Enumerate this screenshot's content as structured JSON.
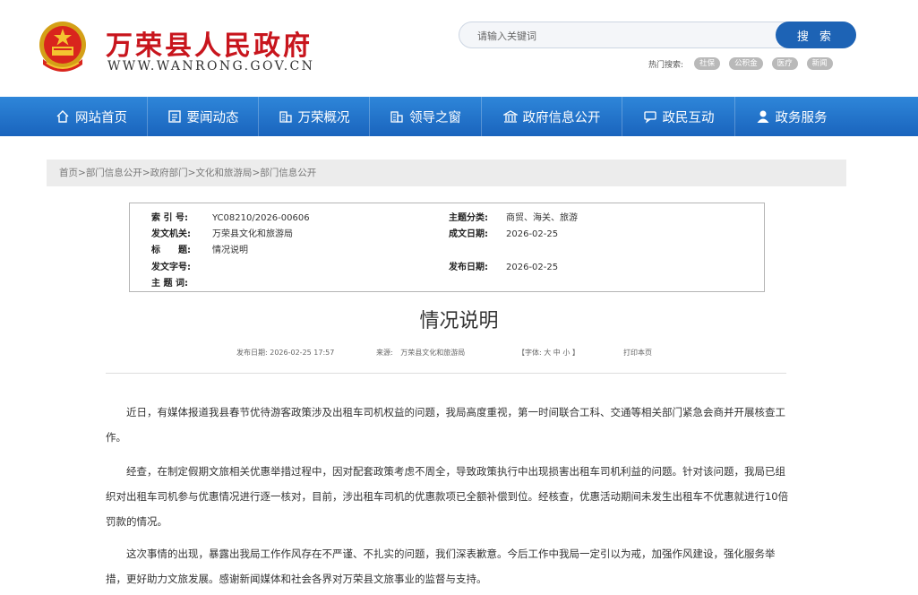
{
  "header": {
    "title": "万荣县人民政府",
    "domain": "WWW.WANRONG.GOV.CN",
    "search": {
      "placeholder": "请输入关键词",
      "button_label": "搜 索"
    },
    "hotwords": {
      "label": "热门搜索:",
      "tags": [
        "社保",
        "公积金",
        "医疗",
        "新闻"
      ]
    }
  },
  "nav": {
    "items": [
      {
        "label": "网站首页",
        "icon": "home-icon"
      },
      {
        "label": "要闻动态",
        "icon": "news-icon"
      },
      {
        "label": "万荣概况",
        "icon": "building-icon"
      },
      {
        "label": "领导之窗",
        "icon": "building-icon"
      },
      {
        "label": "政府信息公开",
        "icon": "government-icon"
      },
      {
        "label": "政民互动",
        "icon": "chat-icon"
      },
      {
        "label": "政务服务",
        "icon": "user-icon"
      }
    ]
  },
  "breadcrumb": [
    "首页",
    "部门信息公开",
    "政府部门",
    "文化和旅游局",
    "部门信息公开"
  ],
  "info": {
    "index_label": "索 引 号:",
    "index_value": "YC08210/2026-00606",
    "org_label": "发文机关:",
    "org_value": "万荣县文化和旅游局",
    "title_label": "标　　题:",
    "title_value": "情况说明",
    "doc_no_label": "发文字号:",
    "doc_no_value": "",
    "keywords_label": "主 题 词:",
    "keywords_value": "",
    "topic_label": "主题分类:",
    "topic_value": "商贸、海关、旅游",
    "created_label": "成文日期:",
    "created_value": "2026-02-25",
    "published_label": "发布日期:",
    "published_value": "2026-02-25"
  },
  "article": {
    "title": "情况说明",
    "meta": {
      "date_label": "发布日期:",
      "date_value": "2026-02-25 17:57",
      "source_label": "来源:",
      "source_value": "万荣县文化和旅游局",
      "font_label": "【字体:",
      "font_large": "大",
      "font_medium": "中",
      "font_small": "小",
      "font_close": "】",
      "print_label": "打印本页"
    },
    "paragraphs": [
      "近日，有媒体报道我县春节优待游客政策涉及出租车司机权益的问题，我局高度重视，第一时间联合工科、交通等相关部门紧急会商并开展核查工作。",
      "经查，在制定假期文旅相关优惠举措过程中，因对配套政策考虑不周全，导致政策执行中出现损害出租车司机利益的问题。针对该问题，我局已组织对出租车司机参与优惠情况进行逐一核对，目前，涉出租车司机的优惠款项已全额补偿到位。经核查，优惠活动期间未发生出租车不优惠就进行10倍罚款的情况。",
      "这次事情的出现，暴露出我局工作作风存在不严谨、不扎实的问题，我们深表歉意。今后工作中我局一定引以为戒，加强作风建设，强化服务举措，更好助力文旅发展。感谢新闻媒体和社会各界对万荣县文旅事业的监督与支持。"
    ]
  },
  "colors": {
    "brand_red": "#c8151d",
    "nav_blue": "#1a64bd",
    "search_button": "#1d63b5"
  }
}
